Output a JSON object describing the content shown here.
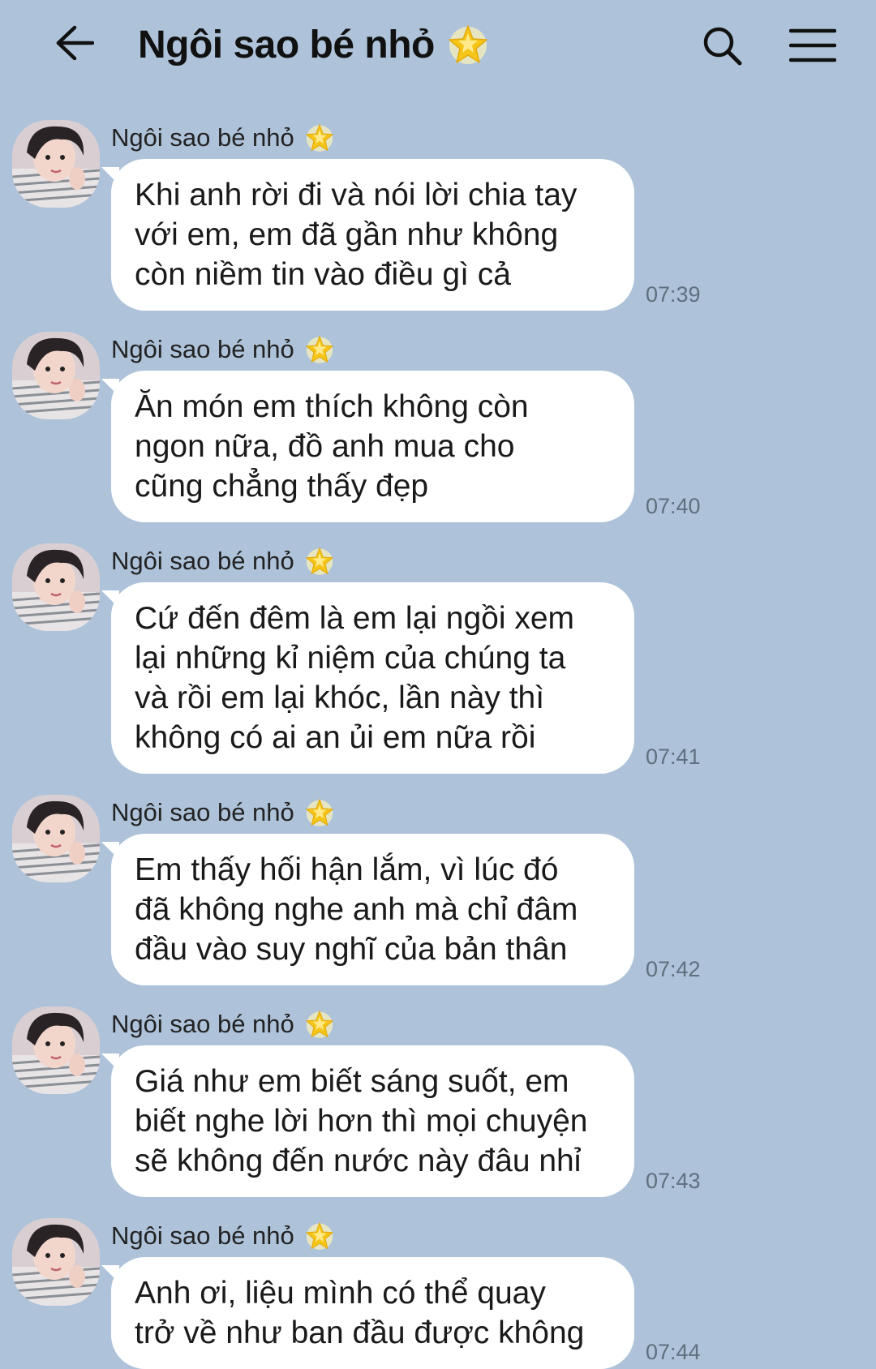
{
  "header": {
    "title": "Ngôi sao bé nhỏ",
    "back_icon": "arrow-left-icon",
    "search_icon": "search-icon",
    "menu_icon": "hamburger-menu-icon",
    "title_icon": "glowing-star-icon"
  },
  "colors": {
    "background": "#aec3d9",
    "bubble": "#ffffff",
    "star": "#f5c518",
    "timestamp": "#5f6f80"
  },
  "messages": [
    {
      "sender": "Ngôi sao bé nhỏ",
      "text": "Khi anh rời đi và nói lời chia tay\nvới em, em đã gần như không\ncòn niềm tin vào điều gì cả",
      "time": "07:39"
    },
    {
      "sender": "Ngôi sao bé nhỏ",
      "text": "Ăn món em thích không còn\nngon nữa, đồ anh mua cho\ncũng chẳng thấy đẹp",
      "time": "07:40"
    },
    {
      "sender": "Ngôi sao bé nhỏ",
      "text": "Cứ đến đêm là em lại ngồi xem\nlại những kỉ niệm của chúng ta\nvà rồi em lại khóc, lần này thì\nkhông có ai an ủi em nữa rồi",
      "time": "07:41"
    },
    {
      "sender": "Ngôi sao bé nhỏ",
      "text": "Em thấy hối hận lắm, vì lúc đó\nđã không nghe anh mà chỉ đâm\nđầu vào suy nghĩ của bản thân",
      "time": "07:42"
    },
    {
      "sender": "Ngôi sao bé nhỏ",
      "text": "Giá như em biết sáng suốt, em\nbiết nghe lời hơn thì mọi chuyện\nsẽ không đến nước này đâu nhỉ",
      "time": "07:43"
    },
    {
      "sender": "Ngôi sao bé nhỏ",
      "text": "Anh ơi, liệu mình có thể quay\ntrở về như ban đầu được không",
      "time": "07:44"
    }
  ]
}
